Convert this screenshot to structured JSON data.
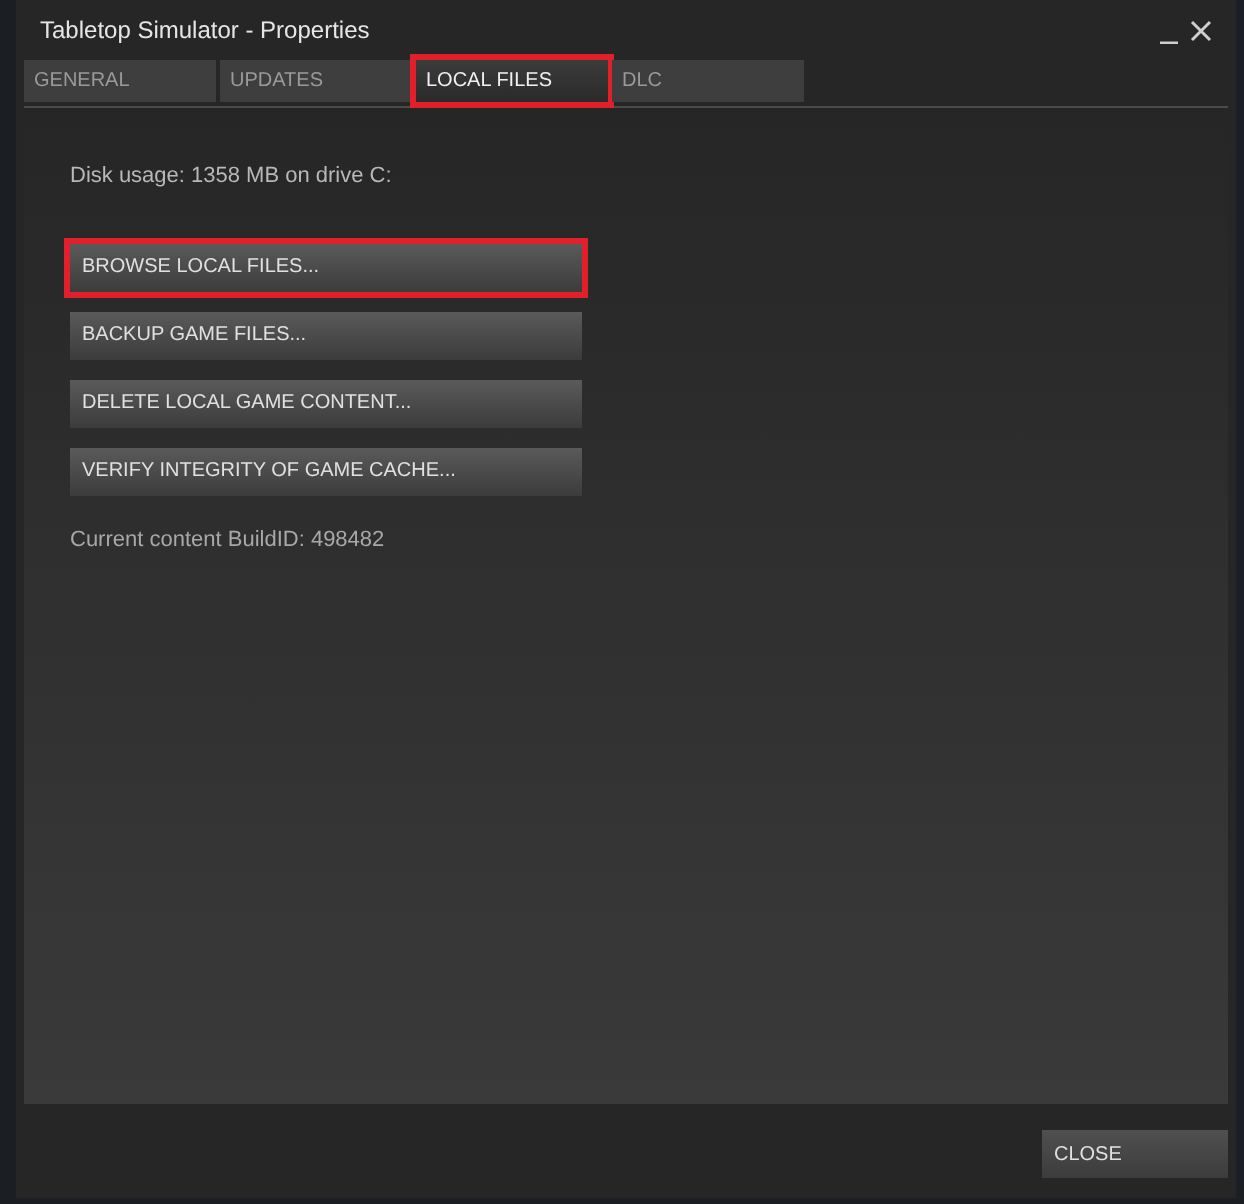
{
  "window": {
    "title": "Tabletop Simulator - Properties"
  },
  "tabs": [
    {
      "label": "GENERAL",
      "selected": false,
      "highlighted": false
    },
    {
      "label": "UPDATES",
      "selected": false,
      "highlighted": false
    },
    {
      "label": "LOCAL FILES",
      "selected": true,
      "highlighted": true
    },
    {
      "label": "DLC",
      "selected": false,
      "highlighted": false
    }
  ],
  "disk_usage": "Disk usage: 1358 MB on drive C:",
  "buttons": [
    {
      "label": "BROWSE LOCAL FILES...",
      "highlighted": true
    },
    {
      "label": "BACKUP GAME FILES...",
      "highlighted": false
    },
    {
      "label": "DELETE LOCAL GAME CONTENT...",
      "highlighted": false
    },
    {
      "label": "VERIFY INTEGRITY OF GAME CACHE...",
      "highlighted": false
    }
  ],
  "build_id": "Current content BuildID: 498482",
  "close_button": "CLOSE"
}
